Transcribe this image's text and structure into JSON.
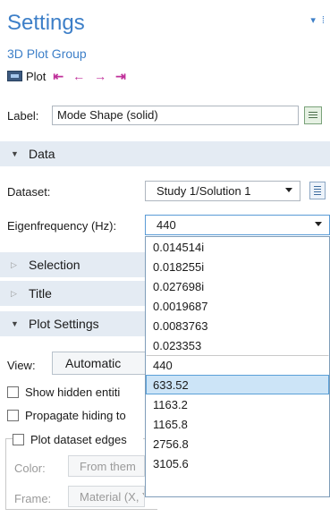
{
  "header": {
    "title": "Settings",
    "subtitle": "3D Plot Group",
    "plot_label": "Plot",
    "nav_first": "⇤",
    "nav_prev": "←",
    "nav_next": "→",
    "nav_last": "⇥",
    "title_arrows": "▾ ⁞"
  },
  "label_field": {
    "label": "Label:",
    "value": "Mode Shape (solid)"
  },
  "sections": {
    "data": "Data",
    "selection": "Selection",
    "title": "Title",
    "plot_settings": "Plot Settings"
  },
  "data": {
    "dataset_label": "Dataset:",
    "dataset_value": "Study 1/Solution 1",
    "eigen_label": "Eigenfrequency (Hz):",
    "eigen_value": "440"
  },
  "eigen_options": [
    "0.014514i",
    "0.018255i",
    "0.027698i",
    "0.0019687",
    "0.0083763",
    "0.023353",
    "440",
    "633.52",
    "1163.2",
    "1165.8",
    "2756.8",
    "3105.6"
  ],
  "eigen_highlighted": "633.52",
  "plot_settings": {
    "view_label": "View:",
    "view_value": "Automatic",
    "show_hidden": "Show hidden entiti",
    "propagate_hiding": "Propagate hiding to",
    "plot_edges": "Plot dataset edges",
    "color_label": "Color:",
    "color_value": "From them",
    "frame_label": "Frame:",
    "frame_value": "Material  (X, Y, Z)"
  },
  "colors": {
    "accent": "#3d7fc8",
    "section_bg": "#e4ebf3",
    "highlight": "#cce4f7",
    "nav_arrow": "#c0309a"
  }
}
